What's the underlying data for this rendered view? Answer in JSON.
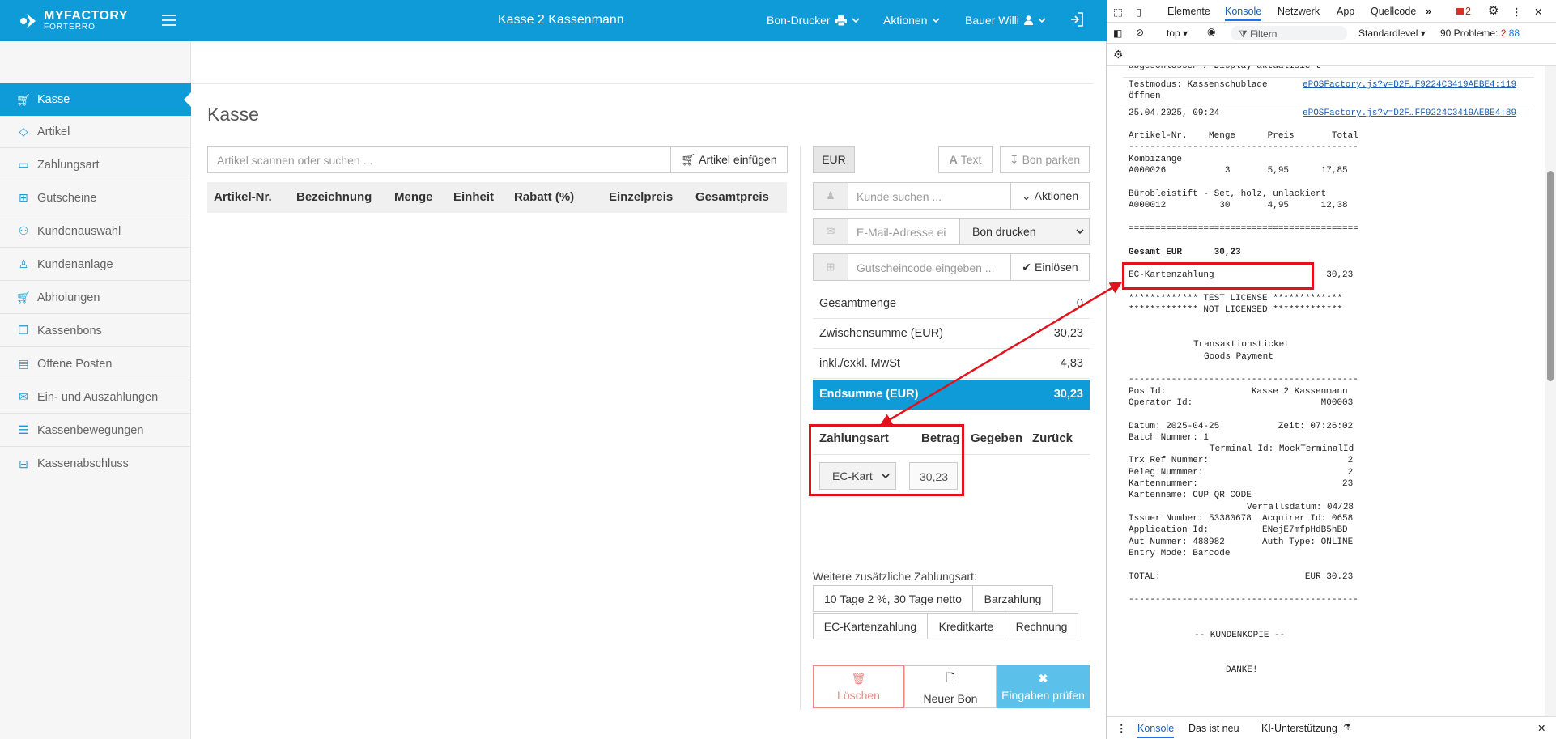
{
  "header": {
    "logo_line1": "MYFACTORY",
    "logo_line2": "FORTERRO",
    "title": "Kasse 2 Kassenmann",
    "menu_printer": "Bon-Drucker",
    "menu_actions": "Aktionen",
    "menu_user": "Bauer Willi"
  },
  "sidebar": {
    "items": [
      {
        "label": "Kasse",
        "icon": "cart-icon"
      },
      {
        "label": "Artikel",
        "icon": "tag-icon"
      },
      {
        "label": "Zahlungsart",
        "icon": "credit-card-icon"
      },
      {
        "label": "Gutscheine",
        "icon": "gift-icon"
      },
      {
        "label": "Kundenauswahl",
        "icon": "users-icon"
      },
      {
        "label": "Kundenanlage",
        "icon": "user-icon"
      },
      {
        "label": "Abholungen",
        "icon": "cart-icon"
      },
      {
        "label": "Kassenbons",
        "icon": "copy-icon"
      },
      {
        "label": "Offene Posten",
        "icon": "book-icon"
      },
      {
        "label": "Ein- und Auszahlungen",
        "icon": "envelope-icon"
      },
      {
        "label": "Kassenbewegungen",
        "icon": "list-icon"
      },
      {
        "label": "Kassenabschluss",
        "icon": "table-icon"
      }
    ]
  },
  "main": {
    "page_title": "Kasse",
    "search_placeholder": "Artikel scannen oder suchen ...",
    "insert_button": "Artikel einfügen",
    "table_headers": [
      "Artikel-Nr.",
      "Bezeichnung",
      "Menge",
      "Einheit",
      "Rabatt (%)",
      "Einzelpreis",
      "Gesamtpreis"
    ]
  },
  "right": {
    "currency": "EUR",
    "text_button": "Text",
    "park_button": "Bon parken",
    "customer_placeholder": "Kunde suchen ...",
    "actions_button": "Aktionen",
    "email_placeholder": "E-Mail-Adresse ei",
    "print_select": "Bon drucken",
    "voucher_placeholder": "Gutscheincode eingeben ...",
    "redeem_button": "Einlösen",
    "summary": [
      {
        "label": "Gesamtmenge",
        "value": "0"
      },
      {
        "label": "Zwischensumme (EUR)",
        "value": "30,23"
      },
      {
        "label": "inkl./exkl. MwSt",
        "value": "4,83"
      },
      {
        "label": "Endsumme (EUR)",
        "value": "30,23"
      }
    ],
    "payment_headers": [
      "Zahlungsart",
      "Betrag",
      "Gegeben",
      "Zurück"
    ],
    "payment_method": "EC-Kart",
    "payment_amount": "30,23",
    "further_label": "Weitere zusätzliche Zahlungsart:",
    "payment_options": [
      "10 Tage 2 %, 30 Tage netto",
      "Barzahlung",
      "EC-Kartenzahlung",
      "Kreditkarte",
      "Rechnung"
    ],
    "delete_button": "Löschen",
    "new_bon_button": "Neuer Bon",
    "check_button": "Eingaben prüfen"
  },
  "devtools": {
    "tabs": [
      "Elemente",
      "Konsole",
      "Netzwerk",
      "App",
      "Quellcode"
    ],
    "error_count": "2",
    "context": "top",
    "filter_placeholder": "Filtern",
    "level": "Standardlevel",
    "problems": "90 Probleme:",
    "problems_errors": "2",
    "problems_msgs": "88",
    "footer_tabs": [
      "Konsole",
      "Das ist neu",
      "KI-Unterstützung"
    ],
    "console_lines": [
      "abgeschlossen / Display aktualisiert",
      "Testmodus: Kassenschublade",
      "öffnen",
      "25.04.2025, 09:24",
      "Artikel-Nr.    Menge      Preis       Total",
      "-------------------------------------------",
      "Kombizange",
      "A000026           3       5,95      17,85",
      "Bürobleistift - Set, holz, unlackiert",
      "A000012          30       4,95      12,38",
      "===========================================",
      "Gesamt EUR      30,23",
      "EC-Kartenzahlung                     30,23",
      "************* TEST LICENSE *************",
      "************* NOT LICENSED *************",
      "Transaktionsticket",
      "Goods Payment",
      "-------------------------------------------",
      "Pos Id:                Kasse 2 Kassenmann",
      "Operator Id:                        M00003",
      "Datum: 2025-04-25           Zeit: 07:26:02",
      "Batch Nummer: 1",
      "Terminal Id: MockTerminalId",
      "Trx Ref Nummer:                          2",
      "Beleg Nummmer:                           2",
      "Kartennummer:                           23",
      "Kartenname: CUP QR CODE",
      "Verfallsdatum: 04/28",
      "Issuer Number: 53380678  Acquirer Id: 0658",
      "Application Id:          ENejE7mfpHdB5hBD",
      "Aut Nummer: 488982       Auth Type: ONLINE",
      "Entry Mode: Barcode",
      "TOTAL:                           EUR 30.23",
      "-------------------------------------------",
      "-- KUNDENKOPIE --",
      "DANKE!"
    ],
    "source_1": "ePOSFactory.js?v=D2F…F9224C3419AEBE4:119",
    "source_2": "ePOSFactory.js?v=D2F…FF9224C3419AEBE4:89"
  }
}
